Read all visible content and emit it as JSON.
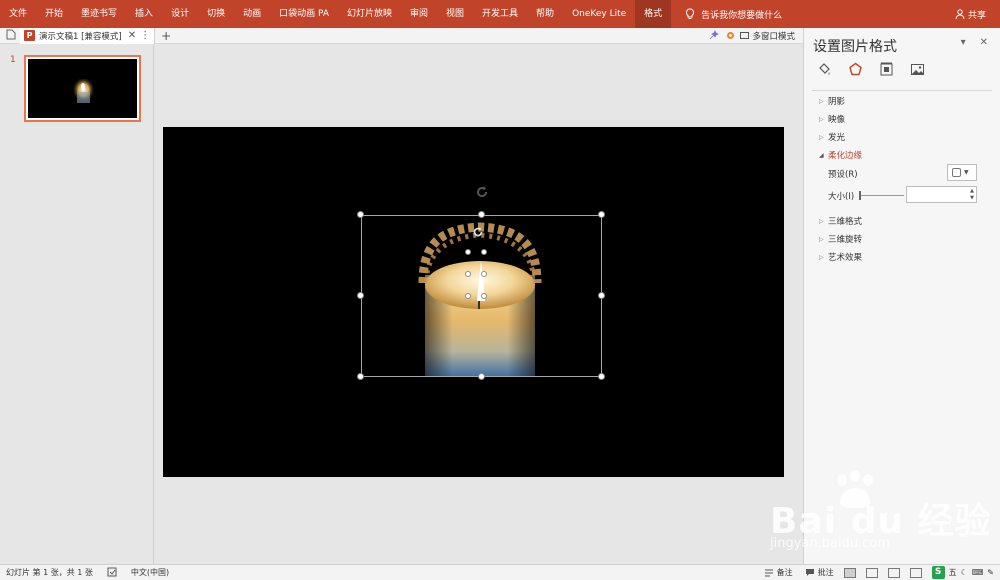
{
  "ribbon": {
    "tabs": [
      "文件",
      "开始",
      "墨迹书写",
      "插入",
      "设计",
      "切换",
      "动画",
      "口袋动画 PA",
      "幻灯片放映",
      "审阅",
      "视图",
      "开发工具",
      "帮助",
      "OneKey Lite",
      "格式"
    ],
    "active_tab": "格式",
    "tell_me": "告诉我你想要做什么",
    "share": "共享",
    "color": "#c0432a"
  },
  "doctab": {
    "name": "演示文稿1 [兼容模式]",
    "close": "✕",
    "more": "⋮",
    "new": "+",
    "multi_window": "多窗口模式"
  },
  "thumbnail": {
    "number": "1"
  },
  "panel": {
    "title": "设置图片格式",
    "dropdown": "▾",
    "close": "✕",
    "icons": [
      "fill-line-icon",
      "effects-icon",
      "size-properties-icon",
      "picture-icon"
    ],
    "sections": [
      {
        "label": "阴影",
        "open": false
      },
      {
        "label": "映像",
        "open": false
      },
      {
        "label": "发光",
        "open": false
      },
      {
        "label": "柔化边缘",
        "open": true
      },
      {
        "label": "三维格式",
        "open": false
      },
      {
        "label": "三维旋转",
        "open": false
      },
      {
        "label": "艺术效果",
        "open": false
      }
    ],
    "preset_label": "预设(R)",
    "size_label": "大小(I)",
    "size_value": ""
  },
  "status": {
    "slide_info": "幻灯片 第 1 张，共 1 张",
    "language": "中文(中国)",
    "notes": "备注",
    "comments": "批注",
    "ime": "五"
  },
  "watermark": {
    "brand": "Bai du 经验",
    "url": "jingyan.baidu.com"
  }
}
